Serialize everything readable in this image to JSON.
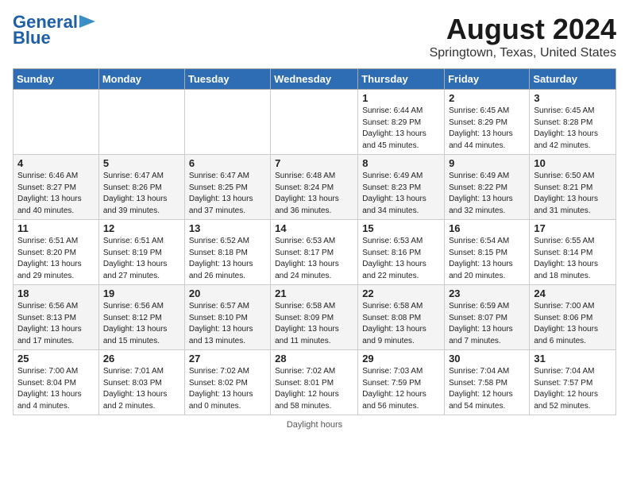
{
  "header": {
    "logo_line1": "General",
    "logo_line2": "Blue",
    "month_year": "August 2024",
    "location": "Springtown, Texas, United States"
  },
  "days_of_week": [
    "Sunday",
    "Monday",
    "Tuesday",
    "Wednesday",
    "Thursday",
    "Friday",
    "Saturday"
  ],
  "weeks": [
    [
      {
        "day": "",
        "info": ""
      },
      {
        "day": "",
        "info": ""
      },
      {
        "day": "",
        "info": ""
      },
      {
        "day": "",
        "info": ""
      },
      {
        "day": "1",
        "info": "Sunrise: 6:44 AM\nSunset: 8:29 PM\nDaylight: 13 hours\nand 45 minutes."
      },
      {
        "day": "2",
        "info": "Sunrise: 6:45 AM\nSunset: 8:29 PM\nDaylight: 13 hours\nand 44 minutes."
      },
      {
        "day": "3",
        "info": "Sunrise: 6:45 AM\nSunset: 8:28 PM\nDaylight: 13 hours\nand 42 minutes."
      }
    ],
    [
      {
        "day": "4",
        "info": "Sunrise: 6:46 AM\nSunset: 8:27 PM\nDaylight: 13 hours\nand 40 minutes."
      },
      {
        "day": "5",
        "info": "Sunrise: 6:47 AM\nSunset: 8:26 PM\nDaylight: 13 hours\nand 39 minutes."
      },
      {
        "day": "6",
        "info": "Sunrise: 6:47 AM\nSunset: 8:25 PM\nDaylight: 13 hours\nand 37 minutes."
      },
      {
        "day": "7",
        "info": "Sunrise: 6:48 AM\nSunset: 8:24 PM\nDaylight: 13 hours\nand 36 minutes."
      },
      {
        "day": "8",
        "info": "Sunrise: 6:49 AM\nSunset: 8:23 PM\nDaylight: 13 hours\nand 34 minutes."
      },
      {
        "day": "9",
        "info": "Sunrise: 6:49 AM\nSunset: 8:22 PM\nDaylight: 13 hours\nand 32 minutes."
      },
      {
        "day": "10",
        "info": "Sunrise: 6:50 AM\nSunset: 8:21 PM\nDaylight: 13 hours\nand 31 minutes."
      }
    ],
    [
      {
        "day": "11",
        "info": "Sunrise: 6:51 AM\nSunset: 8:20 PM\nDaylight: 13 hours\nand 29 minutes."
      },
      {
        "day": "12",
        "info": "Sunrise: 6:51 AM\nSunset: 8:19 PM\nDaylight: 13 hours\nand 27 minutes."
      },
      {
        "day": "13",
        "info": "Sunrise: 6:52 AM\nSunset: 8:18 PM\nDaylight: 13 hours\nand 26 minutes."
      },
      {
        "day": "14",
        "info": "Sunrise: 6:53 AM\nSunset: 8:17 PM\nDaylight: 13 hours\nand 24 minutes."
      },
      {
        "day": "15",
        "info": "Sunrise: 6:53 AM\nSunset: 8:16 PM\nDaylight: 13 hours\nand 22 minutes."
      },
      {
        "day": "16",
        "info": "Sunrise: 6:54 AM\nSunset: 8:15 PM\nDaylight: 13 hours\nand 20 minutes."
      },
      {
        "day": "17",
        "info": "Sunrise: 6:55 AM\nSunset: 8:14 PM\nDaylight: 13 hours\nand 18 minutes."
      }
    ],
    [
      {
        "day": "18",
        "info": "Sunrise: 6:56 AM\nSunset: 8:13 PM\nDaylight: 13 hours\nand 17 minutes."
      },
      {
        "day": "19",
        "info": "Sunrise: 6:56 AM\nSunset: 8:12 PM\nDaylight: 13 hours\nand 15 minutes."
      },
      {
        "day": "20",
        "info": "Sunrise: 6:57 AM\nSunset: 8:10 PM\nDaylight: 13 hours\nand 13 minutes."
      },
      {
        "day": "21",
        "info": "Sunrise: 6:58 AM\nSunset: 8:09 PM\nDaylight: 13 hours\nand 11 minutes."
      },
      {
        "day": "22",
        "info": "Sunrise: 6:58 AM\nSunset: 8:08 PM\nDaylight: 13 hours\nand 9 minutes."
      },
      {
        "day": "23",
        "info": "Sunrise: 6:59 AM\nSunset: 8:07 PM\nDaylight: 13 hours\nand 7 minutes."
      },
      {
        "day": "24",
        "info": "Sunrise: 7:00 AM\nSunset: 8:06 PM\nDaylight: 13 hours\nand 6 minutes."
      }
    ],
    [
      {
        "day": "25",
        "info": "Sunrise: 7:00 AM\nSunset: 8:04 PM\nDaylight: 13 hours\nand 4 minutes."
      },
      {
        "day": "26",
        "info": "Sunrise: 7:01 AM\nSunset: 8:03 PM\nDaylight: 13 hours\nand 2 minutes."
      },
      {
        "day": "27",
        "info": "Sunrise: 7:02 AM\nSunset: 8:02 PM\nDaylight: 13 hours\nand 0 minutes."
      },
      {
        "day": "28",
        "info": "Sunrise: 7:02 AM\nSunset: 8:01 PM\nDaylight: 12 hours\nand 58 minutes."
      },
      {
        "day": "29",
        "info": "Sunrise: 7:03 AM\nSunset: 7:59 PM\nDaylight: 12 hours\nand 56 minutes."
      },
      {
        "day": "30",
        "info": "Sunrise: 7:04 AM\nSunset: 7:58 PM\nDaylight: 12 hours\nand 54 minutes."
      },
      {
        "day": "31",
        "info": "Sunrise: 7:04 AM\nSunset: 7:57 PM\nDaylight: 12 hours\nand 52 minutes."
      }
    ]
  ],
  "footer": {
    "note": "Daylight hours"
  }
}
